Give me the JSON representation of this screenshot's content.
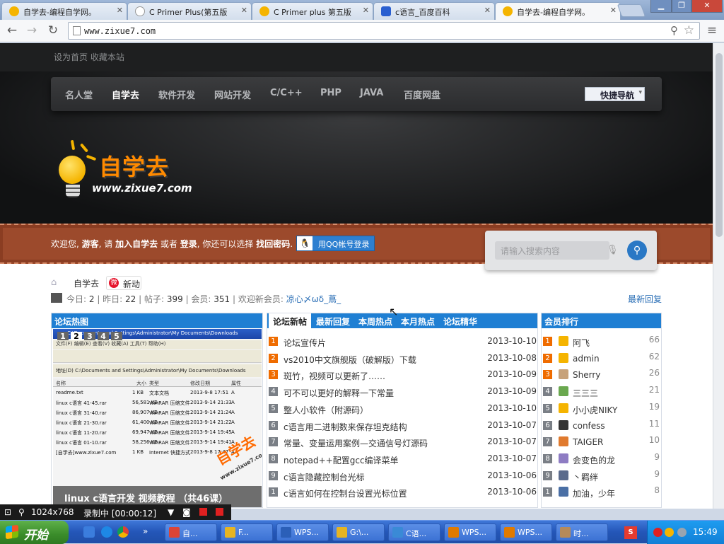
{
  "browser": {
    "tabs": [
      {
        "label": "自学去-编程自学网。",
        "icon_color": "#f5b400"
      },
      {
        "label": "C Primer Plus(第五版",
        "icon_color": "#ffffff"
      },
      {
        "label": "C Primer plus 第五版",
        "icon_color": "#f5b400"
      },
      {
        "label": "c语言_百度百科",
        "icon_color": "#2a5fd0"
      },
      {
        "label": "自学去-编程自学网。",
        "icon_color": "#f5b400"
      }
    ],
    "url": "www.zixue7.com"
  },
  "site": {
    "top_links": "设为首页  收藏本站",
    "nav": [
      "名人堂",
      "自学去",
      "软件开发",
      "网站开发",
      "C/C++",
      "PHP",
      "JAVA",
      "百度网盘"
    ],
    "quick_nav": "快捷导航",
    "logo_cn": "自学去",
    "logo_domain": "www.zixue7.com",
    "welcome": {
      "w1": "欢迎您, ",
      "guest": "游客",
      "w2": ", 请 ",
      "join": "加入自学去",
      "w3": " 或者 ",
      "login": "登录",
      "w4": ", 你还可以选择 ",
      "forgot": "找回密码",
      "w5": "."
    },
    "qq_login": "用QQ帐号登录",
    "search_placeholder": "请输入搜索内容",
    "crumb_home": "自学去",
    "weibo_label": "新动",
    "stats": {
      "today_label": "今日: ",
      "today": "2",
      "yesterday_label": "昨日: ",
      "yesterday": "22",
      "posts_label": "帖子: ",
      "posts": "399",
      "members_label": "会员: ",
      "members": "351",
      "newest_label": "欢迎新会员: ",
      "newest": "凉心〆ωδ_蔦_",
      "latest_reply": "最新回复"
    },
    "hot": {
      "title": "论坛热图",
      "slide_numbers": [
        "1",
        "2",
        "3",
        "4",
        "5"
      ],
      "window_title": "C:\\Documents and Settings\\Administrator\\My Documents\\Downloads",
      "menu": "文件(F)  编辑(E)  查看(V)  收藏(A)  工具(T)  帮助(H)",
      "address": "地址(D)  C:\\Documents and Settings\\Administrator\\My Documents\\Downloads",
      "columns": [
        "名称",
        "大小",
        "类型",
        "修改日期",
        "属性"
      ],
      "files": [
        [
          "readme.txt",
          "1 KB",
          "文本文档",
          "2013-9-8 17:51",
          "A"
        ],
        [
          "linux c语言 41-45.rar",
          "56,581 KB",
          "WinRAR 压缩文件",
          "2013-9-14 21:33",
          "A"
        ],
        [
          "linux c语言 31-40.rar",
          "86,907 KB",
          "WinRAR 压缩文件",
          "2013-9-14 21:24",
          "A"
        ],
        [
          "linux c语言 21-30.rar",
          "61,400 KB",
          "WinRAR 压缩文件",
          "2013-9-14 21:22",
          "A"
        ],
        [
          "linux c语言 11-20.rar",
          "69,947 KB",
          "WinRAR 压缩文件",
          "2013-9-14 19:45",
          "A"
        ],
        [
          "linux c语言 01-10.rar",
          "58,256 KB",
          "WinRAR 压缩文件",
          "2013-9-14 19:41",
          "A"
        ],
        [
          "[自学去]www.zixue7.com",
          "1 KB",
          "Internet 快捷方式",
          "2013-9-8 17:47",
          "A"
        ]
      ],
      "stamp_cn": "自学去",
      "stamp_domain": "www.zixue7.com",
      "caption": "linux c语言开发 视频教程 （共46课）"
    },
    "thread_tabs": [
      "论坛新帖",
      "最新回复",
      "本周热点",
      "本月热点",
      "论坛精华"
    ],
    "threads": [
      {
        "n": "1",
        "title": "论坛宣传片",
        "date": "2013-10-10"
      },
      {
        "n": "2",
        "title": "vs2010中文旗舰版（破解版）下载",
        "date": "2013-10-08"
      },
      {
        "n": "3",
        "title": "斑竹，视频可以更新了……",
        "date": "2013-10-09"
      },
      {
        "n": "4",
        "title": "可不可以更好的解释一下常量",
        "date": "2013-10-09"
      },
      {
        "n": "5",
        "title": "整人小软件（附源码）",
        "date": "2013-10-10"
      },
      {
        "n": "6",
        "title": "c语言用二进制数来保存坦克结构",
        "date": "2013-10-07"
      },
      {
        "n": "7",
        "title": "常量、变量运用案例—交通信号灯源码",
        "date": "2013-10-07"
      },
      {
        "n": "8",
        "title": "notepad++配置gcc编译菜单",
        "date": "2013-10-07"
      },
      {
        "n": "9",
        "title": "c语言隐藏控制台光标",
        "date": "2013-10-06"
      },
      {
        "n": "1",
        "title": "c语言如何在控制台设置光标位置",
        "date": "2013-10-06"
      }
    ],
    "rank_title": "会员排行",
    "ranks": [
      {
        "n": "1",
        "name": "阿飞",
        "score": "66",
        "avatar_color": "#f5b400"
      },
      {
        "n": "2",
        "name": "admin",
        "score": "62",
        "avatar_color": "#f5b400"
      },
      {
        "n": "3",
        "name": "Sherry",
        "score": "26",
        "avatar_color": "#c7a27a"
      },
      {
        "n": "4",
        "name": "三三三",
        "score": "21",
        "avatar_color": "#6aa84f"
      },
      {
        "n": "5",
        "name": "小小虎NIKY",
        "score": "19",
        "avatar_color": "#f5b400"
      },
      {
        "n": "6",
        "name": "confess",
        "score": "11",
        "avatar_color": "#333333"
      },
      {
        "n": "7",
        "name": "TAIGER",
        "score": "10",
        "avatar_color": "#e07a2e"
      },
      {
        "n": "8",
        "name": "会变色的龙",
        "score": "9",
        "avatar_color": "#8e7cc3"
      },
      {
        "n": "9",
        "name": "丶羁绊",
        "score": "9",
        "avatar_color": "#5b6b8c"
      },
      {
        "n": "1",
        "name": "加油，少年",
        "score": "8",
        "avatar_color": "#4a6fa5"
      }
    ]
  },
  "recorder": {
    "size": "1024x768",
    "status": "录制中 [00:00:12]"
  },
  "taskbar": {
    "start": "开始",
    "buttons": [
      {
        "label": "自...",
        "icon": "chrome-icon",
        "color": "#db4437"
      },
      {
        "label": "F...",
        "icon": "folder-icon",
        "color": "#e6b422"
      },
      {
        "label": "WPS...",
        "icon": "wps-writer-icon",
        "color": "#2b5fb8"
      },
      {
        "label": "G:\\...",
        "icon": "folder-icon",
        "color": "#e6b422"
      },
      {
        "label": "C语...",
        "icon": "c-free-icon",
        "color": "#3a8ad6"
      },
      {
        "label": "WPS...",
        "icon": "wps-presentation-icon",
        "color": "#e07a00"
      },
      {
        "label": "WPS...",
        "icon": "wps-presentation-icon",
        "color": "#e07a00"
      },
      {
        "label": "时...",
        "icon": "people-icon",
        "color": "#b58a5a"
      }
    ],
    "tray_app": "S",
    "clock": "15:49"
  }
}
